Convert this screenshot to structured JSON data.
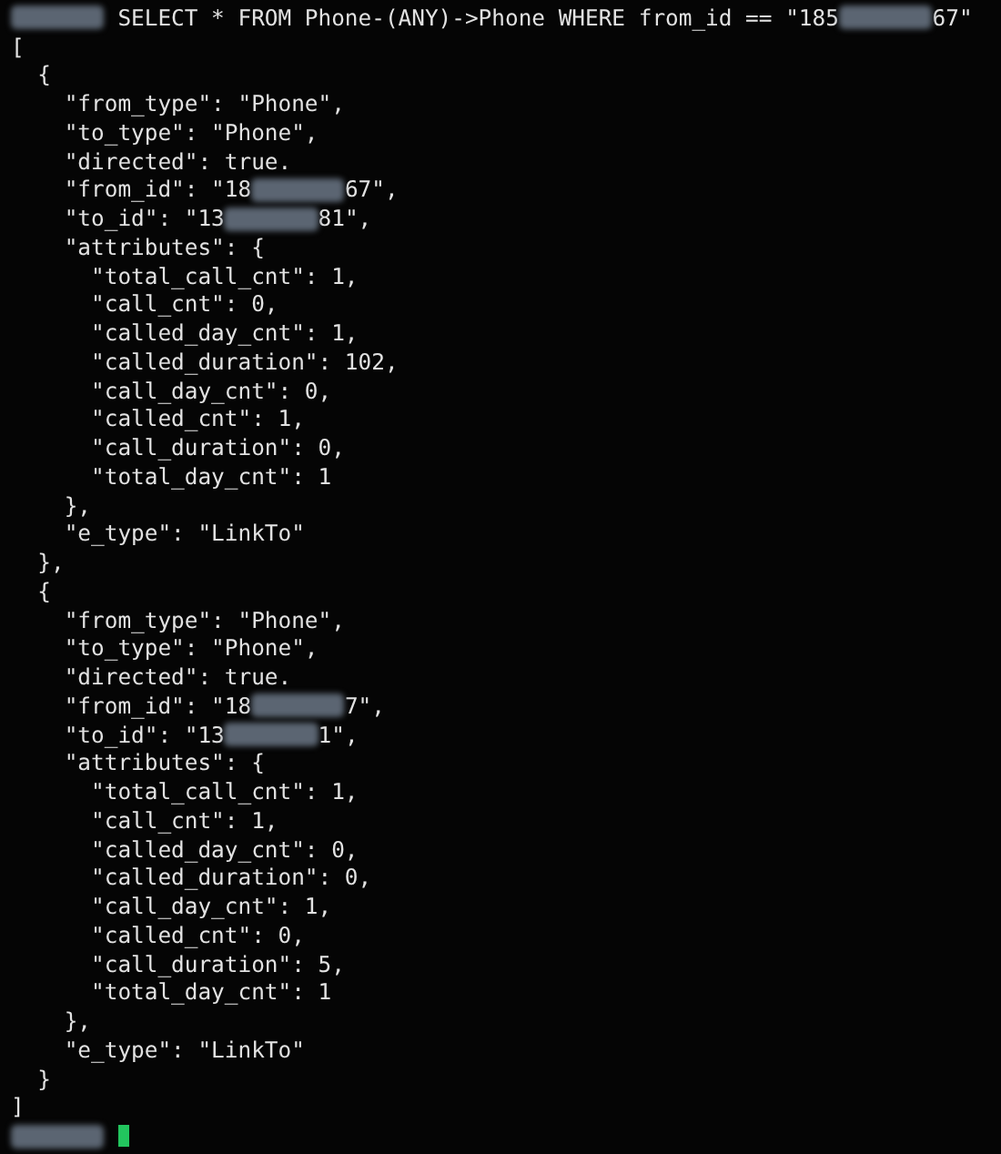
{
  "terminal": {
    "lines": [
      [
        {
          "kind": "redacted"
        },
        {
          "kind": "text",
          "text": " SELECT * FROM Phone-(ANY)->Phone WHERE from_id == \"185"
        },
        {
          "kind": "redacted"
        },
        {
          "kind": "text",
          "text": "67\""
        }
      ],
      [
        {
          "kind": "text",
          "text": "["
        }
      ],
      [
        {
          "kind": "text",
          "text": "  {"
        }
      ],
      [
        {
          "kind": "text",
          "text": "    \"from_type\": \"Phone\","
        }
      ],
      [
        {
          "kind": "text",
          "text": "    \"to_type\": \"Phone\","
        }
      ],
      [
        {
          "kind": "text",
          "text": "    \"directed\": true."
        }
      ],
      [
        {
          "kind": "text",
          "text": "    \"from_id\": \"18"
        },
        {
          "kind": "redacted"
        },
        {
          "kind": "text",
          "text": "67\","
        }
      ],
      [
        {
          "kind": "text",
          "text": "    \"to_id\": \"13"
        },
        {
          "kind": "redacted"
        },
        {
          "kind": "text",
          "text": "81\","
        }
      ],
      [
        {
          "kind": "text",
          "text": "    \"attributes\": {"
        }
      ],
      [
        {
          "kind": "text",
          "text": "      \"total_call_cnt\": 1,"
        }
      ],
      [
        {
          "kind": "text",
          "text": "      \"call_cnt\": 0,"
        }
      ],
      [
        {
          "kind": "text",
          "text": "      \"called_day_cnt\": 1,"
        }
      ],
      [
        {
          "kind": "text",
          "text": "      \"called_duration\": 102,"
        }
      ],
      [
        {
          "kind": "text",
          "text": "      \"call_day_cnt\": 0,"
        }
      ],
      [
        {
          "kind": "text",
          "text": "      \"called_cnt\": 1,"
        }
      ],
      [
        {
          "kind": "text",
          "text": "      \"call_duration\": 0,"
        }
      ],
      [
        {
          "kind": "text",
          "text": "      \"total_day_cnt\": 1"
        }
      ],
      [
        {
          "kind": "text",
          "text": "    },"
        }
      ],
      [
        {
          "kind": "text",
          "text": "    \"e_type\": \"LinkTo\""
        }
      ],
      [
        {
          "kind": "text",
          "text": "  },"
        }
      ],
      [
        {
          "kind": "text",
          "text": "  {"
        }
      ],
      [
        {
          "kind": "text",
          "text": "    \"from_type\": \"Phone\","
        }
      ],
      [
        {
          "kind": "text",
          "text": "    \"to_type\": \"Phone\","
        }
      ],
      [
        {
          "kind": "text",
          "text": "    \"directed\": true."
        }
      ],
      [
        {
          "kind": "text",
          "text": "    \"from_id\": \"18"
        },
        {
          "kind": "redacted"
        },
        {
          "kind": "text",
          "text": "7\","
        }
      ],
      [
        {
          "kind": "text",
          "text": "    \"to_id\": \"13"
        },
        {
          "kind": "redacted"
        },
        {
          "kind": "text",
          "text": "1\","
        }
      ],
      [
        {
          "kind": "text",
          "text": "    \"attributes\": {"
        }
      ],
      [
        {
          "kind": "text",
          "text": "      \"total_call_cnt\": 1,"
        }
      ],
      [
        {
          "kind": "text",
          "text": "      \"call_cnt\": 1,"
        }
      ],
      [
        {
          "kind": "text",
          "text": "      \"called_day_cnt\": 0,"
        }
      ],
      [
        {
          "kind": "text",
          "text": "      \"called_duration\": 0,"
        }
      ],
      [
        {
          "kind": "text",
          "text": "      \"call_day_cnt\": 1,"
        }
      ],
      [
        {
          "kind": "text",
          "text": "      \"called_cnt\": 0,"
        }
      ],
      [
        {
          "kind": "text",
          "text": "      \"call_duration\": 5,"
        }
      ],
      [
        {
          "kind": "text",
          "text": "      \"total_day_cnt\": 1"
        }
      ],
      [
        {
          "kind": "text",
          "text": "    },"
        }
      ],
      [
        {
          "kind": "text",
          "text": "    \"e_type\": \"LinkTo\""
        }
      ],
      [
        {
          "kind": "text",
          "text": "  }"
        }
      ],
      [
        {
          "kind": "text",
          "text": "]"
        }
      ],
      [
        {
          "kind": "redacted"
        },
        {
          "kind": "cursor"
        }
      ]
    ]
  }
}
